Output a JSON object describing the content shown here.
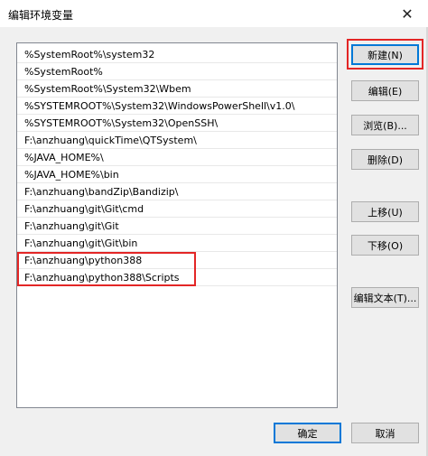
{
  "window": {
    "title": "编辑环境变量",
    "close_glyph": "✕"
  },
  "paths": [
    "%SystemRoot%\\system32",
    "%SystemRoot%",
    "%SystemRoot%\\System32\\Wbem",
    "%SYSTEMROOT%\\System32\\WindowsPowerShell\\v1.0\\",
    "%SYSTEMROOT%\\System32\\OpenSSH\\",
    "F:\\anzhuang\\quickTime\\QTSystem\\",
    "%JAVA_HOME%\\",
    "%JAVA_HOME%\\bin",
    "F:\\anzhuang\\bandZip\\Bandizip\\",
    "F:\\anzhuang\\git\\Git\\cmd",
    "F:\\anzhuang\\git\\Git",
    "F:\\anzhuang\\git\\Git\\bin",
    "F:\\anzhuang\\python388",
    "F:\\anzhuang\\python388\\Scripts"
  ],
  "buttons": {
    "new": "新建(N)",
    "edit": "编辑(E)",
    "browse": "浏览(B)...",
    "delete": "删除(D)",
    "move_up": "上移(U)",
    "move_down": "下移(O)",
    "edit_text": "编辑文本(T)...",
    "ok": "确定",
    "cancel": "取消"
  },
  "colors": {
    "highlight_border": "#e32626",
    "primary_border": "#0078d7"
  }
}
